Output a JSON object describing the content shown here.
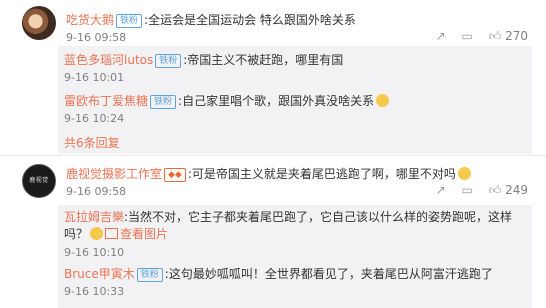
{
  "comments": [
    {
      "user": "吃货大鹅",
      "badge": "铁粉",
      "text": ":全运会是全国运动会 特么跟国外啥关系",
      "time": "9-16 09:58",
      "likes": "270",
      "replies": [
        {
          "user": "蓝色多瑙河lutos",
          "badge": "铁粉",
          "text": ":帝国主义不被赶跑，哪里有国",
          "time": "9-16 10:01"
        },
        {
          "user": "雷欧布丁爱焦糖",
          "badge": "铁粉",
          "text": ":自己家里唱个歌，跟国外真没啥关系",
          "time": "9-16 10:24"
        }
      ],
      "more_replies": "共6条回复"
    },
    {
      "user": "鹿视觉摄影工作室",
      "badge": "",
      "avatar_text": "鹿视觉",
      "text": ":可是帝国主义就是夹着尾巴逃跑了啊，哪里不对吗",
      "time": "9-16 09:58",
      "likes": "249",
      "replies": [
        {
          "user": "瓦拉姆吉樂",
          "badge": "",
          "text": ":当然不对，它主子都夹着尾巴跑了，它自己该以什么样的姿势跑呢，这样吗？",
          "view_image": "查看图片",
          "time": "9-16 10:10"
        },
        {
          "user": "Bruce甲寅木",
          "badge": "铁粉",
          "text": ":这句最妙呱呱叫！全世界都看见了，夹着尾巴从阿富汗逃跑了",
          "time": "9-16 10:33"
        }
      ]
    }
  ],
  "icons": {
    "share": "share-icon",
    "comment": "comment-icon",
    "like": "like-icon"
  }
}
